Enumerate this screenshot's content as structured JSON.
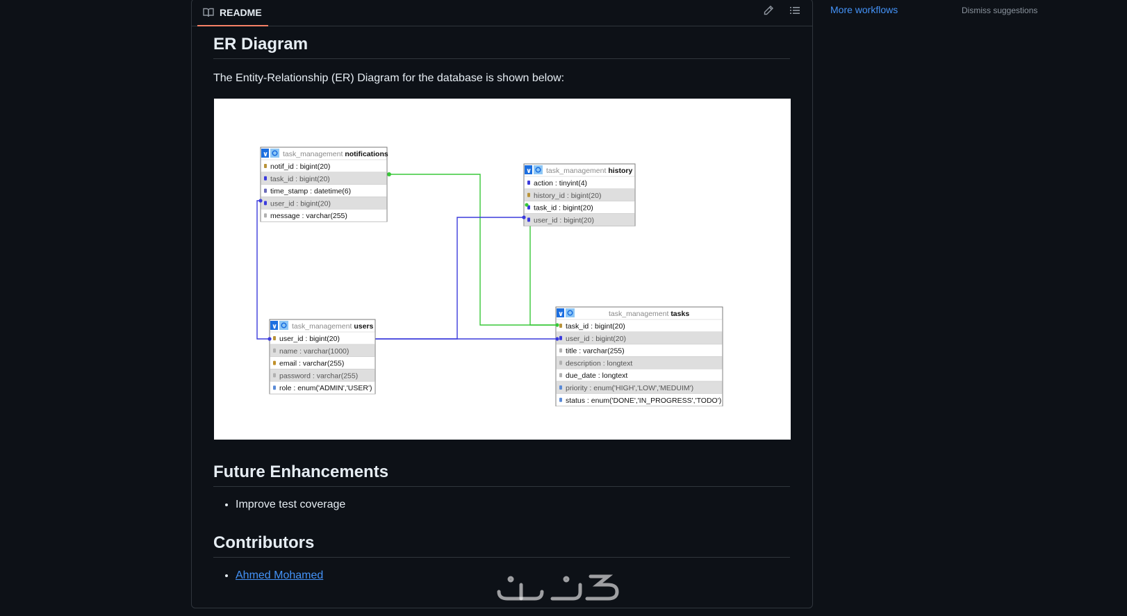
{
  "readme": {
    "tab_label": "README",
    "edit_icon": "pencil-icon",
    "outline_icon": "list-unordered-icon"
  },
  "sidebar": {
    "more_workflows": "More workflows",
    "dismiss": "Dismiss suggestions"
  },
  "sections": {
    "er_title": "ER Diagram",
    "er_intro": "The Entity-Relationship (ER) Diagram for the database is shown below:",
    "future_title": "Future Enhancements",
    "future_items": [
      "Improve test coverage"
    ],
    "contributors_title": "Contributors",
    "contributors": [
      "Ahmed Mohamed"
    ]
  },
  "diagram": {
    "tables": [
      {
        "schema": "task_management",
        "name": "notifications",
        "fields": [
          {
            "text": "notif_id : bigint(20)",
            "key": "primary"
          },
          {
            "text": "task_id : bigint(20)",
            "key": "foreign"
          },
          {
            "text": "time_stamp : datetime(6)",
            "key": "date"
          },
          {
            "text": "user_id : bigint(20)",
            "key": "foreign"
          },
          {
            "text": "message : varchar(255)",
            "key": "text"
          }
        ]
      },
      {
        "schema": "task_management",
        "name": "history",
        "fields": [
          {
            "text": "action : tinyint(4)",
            "key": "number"
          },
          {
            "text": "history_id : bigint(20)",
            "key": "primary"
          },
          {
            "text": "task_id : bigint(20)",
            "key": "foreign"
          },
          {
            "text": "user_id : bigint(20)",
            "key": "foreign"
          }
        ]
      },
      {
        "schema": "task_management",
        "name": "users",
        "fields": [
          {
            "text": "user_id : bigint(20)",
            "key": "primary"
          },
          {
            "text": "name : varchar(1000)",
            "key": "text"
          },
          {
            "text": "email : varchar(255)",
            "key": "unique"
          },
          {
            "text": "password : varchar(255)",
            "key": "text"
          },
          {
            "text": "role : enum('ADMIN','USER')",
            "key": "enum"
          }
        ]
      },
      {
        "schema": "task_management",
        "name": "tasks",
        "fields": [
          {
            "text": "task_id : bigint(20)",
            "key": "primary"
          },
          {
            "text": "user_id : bigint(20)",
            "key": "foreign"
          },
          {
            "text": "title : varchar(255)",
            "key": "text"
          },
          {
            "text": "description : longtext",
            "key": "text"
          },
          {
            "text": "due_date : longtext",
            "key": "text"
          },
          {
            "text": "priority : enum('HIGH','LOW','MEDUIM')",
            "key": "enum"
          },
          {
            "text": "status : enum('DONE','IN_PROGRESS','TODO')",
            "key": "enum"
          }
        ]
      }
    ],
    "colors": {
      "fk_user": "#3b3bdc",
      "fk_task": "#38c738",
      "header_blue": "#1c6fe0"
    }
  }
}
